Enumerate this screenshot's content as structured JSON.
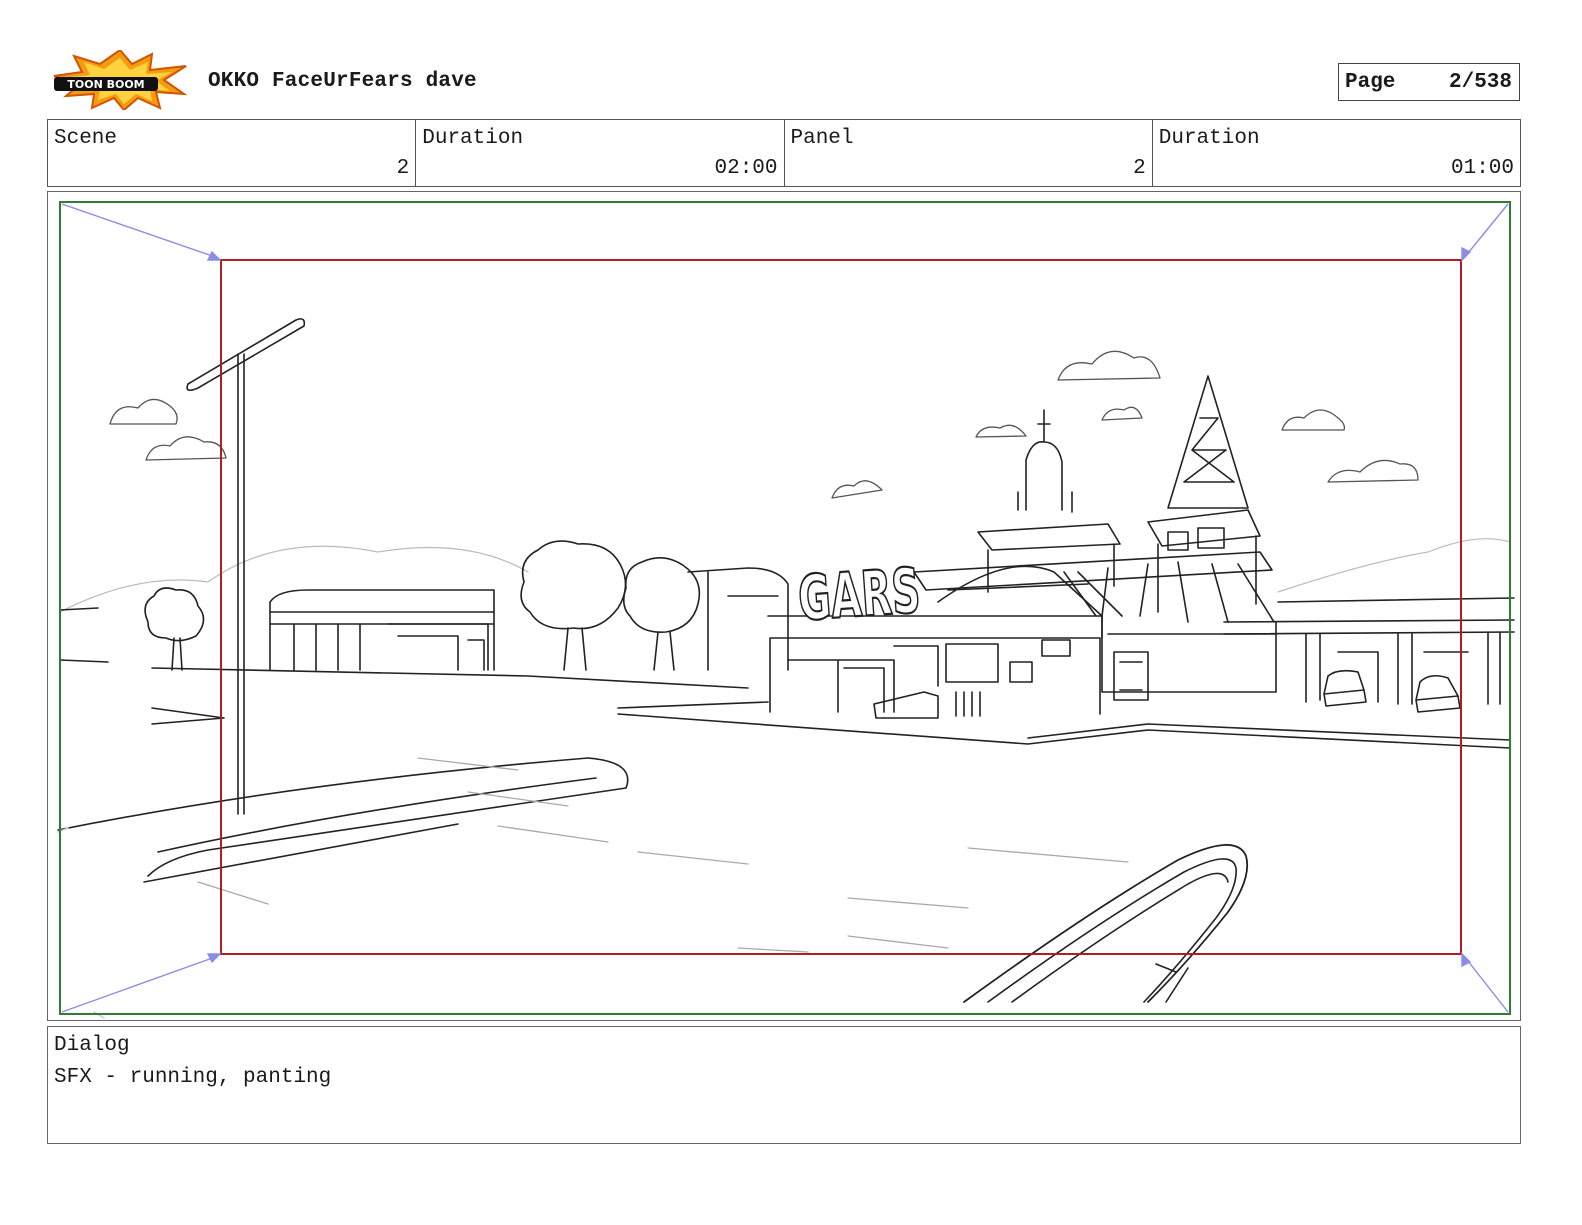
{
  "header": {
    "logo_text": "TOON BOOM",
    "title": "OKKO FaceUrFears dave",
    "page_label": "Page",
    "page_value": "2/538"
  },
  "info": {
    "scene_label": "Scene",
    "scene_value": "2",
    "scene_duration_label": "Duration",
    "scene_duration_value": "02:00",
    "panel_label": "Panel",
    "panel_value": "2",
    "panel_duration_label": "Duration",
    "panel_duration_value": "01:00"
  },
  "panel": {
    "sign_text": "GARS",
    "outer_frame_color": "#2e7d32",
    "camera_frame_color": "#b71c1c",
    "arrow_color": "#8c8ce6"
  },
  "dialog": {
    "label": "Dialog",
    "text": "SFX - running, panting"
  }
}
